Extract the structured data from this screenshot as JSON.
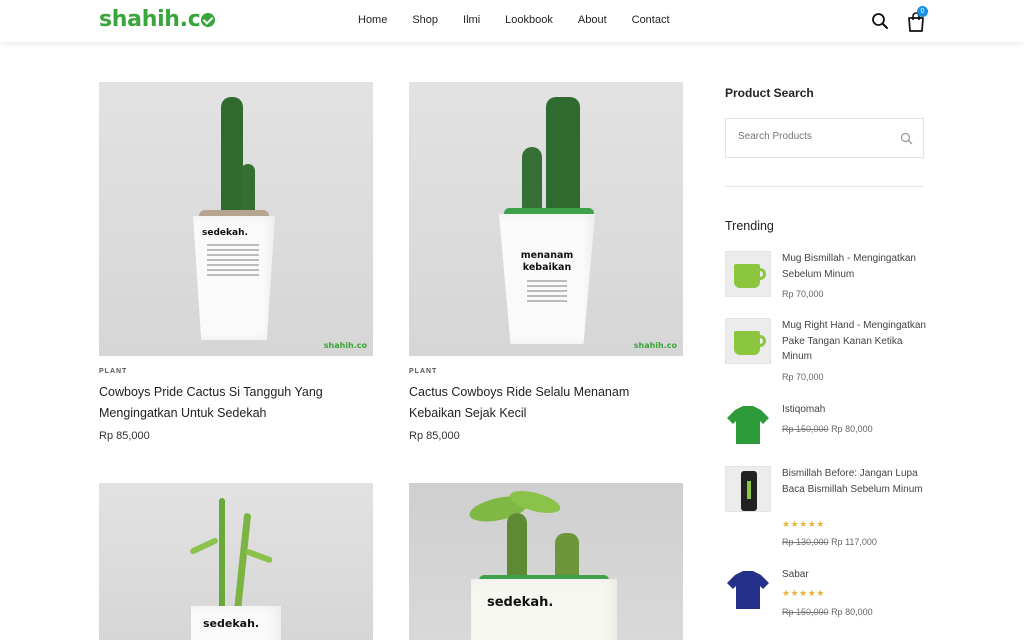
{
  "header": {
    "logo": "shahih.co",
    "nav": [
      "Home",
      "Shop",
      "Ilmi",
      "Lookbook",
      "About",
      "Contact"
    ],
    "cart_count": "0"
  },
  "products": [
    {
      "category": "PLANT",
      "title": "Cowboys Pride Cactus Si Tangguh Yang Mengingatkan Untuk Sedekah",
      "price": "Rp 85,000",
      "pot_text": "sedekah."
    },
    {
      "category": "PLANT",
      "title": "Cactus Cowboys Ride Selalu Menanam Kebaikan Sejak Kecil",
      "price": "Rp 85,000",
      "pot_text": "menanam kebaikan"
    },
    {
      "pot_text": "sedekah."
    },
    {
      "pot_text": "sedekah."
    }
  ],
  "sidebar": {
    "search_heading": "Product Search",
    "search_placeholder": "Search Products",
    "trending_heading": "Trending",
    "trending": [
      {
        "name": "Mug Bismillah - Mengingatkan Sebelum Minum",
        "price": "Rp 70,000",
        "thumb_color": "#8cc63f"
      },
      {
        "name": "Mug Right Hand - Mengingatkan Pake Tangan Kanan Ketika Minum",
        "price": "Rp 70,000",
        "thumb_color": "#8cc63f"
      },
      {
        "name": "Istiqomah",
        "old_price": "Rp 150,000",
        "price": "Rp 80,000",
        "thumb_color": "#2e9b3a"
      },
      {
        "name": "Bismillah Before: Jangan Lupa Baca Bismillah Sebelum Minum",
        "stars": "★★★★★",
        "old_price": "Rp 130,000",
        "price": "Rp 117,000",
        "thumb_color": "#222222"
      },
      {
        "name": "Sabar",
        "stars": "★★★★★",
        "old_price": "Rp 150,000",
        "price": "Rp 80,000",
        "thumb_color": "#24308a"
      }
    ]
  },
  "colors": {
    "brand": "#3aa53a",
    "badge": "#1a8fe3",
    "stars": "#e5b53c"
  }
}
